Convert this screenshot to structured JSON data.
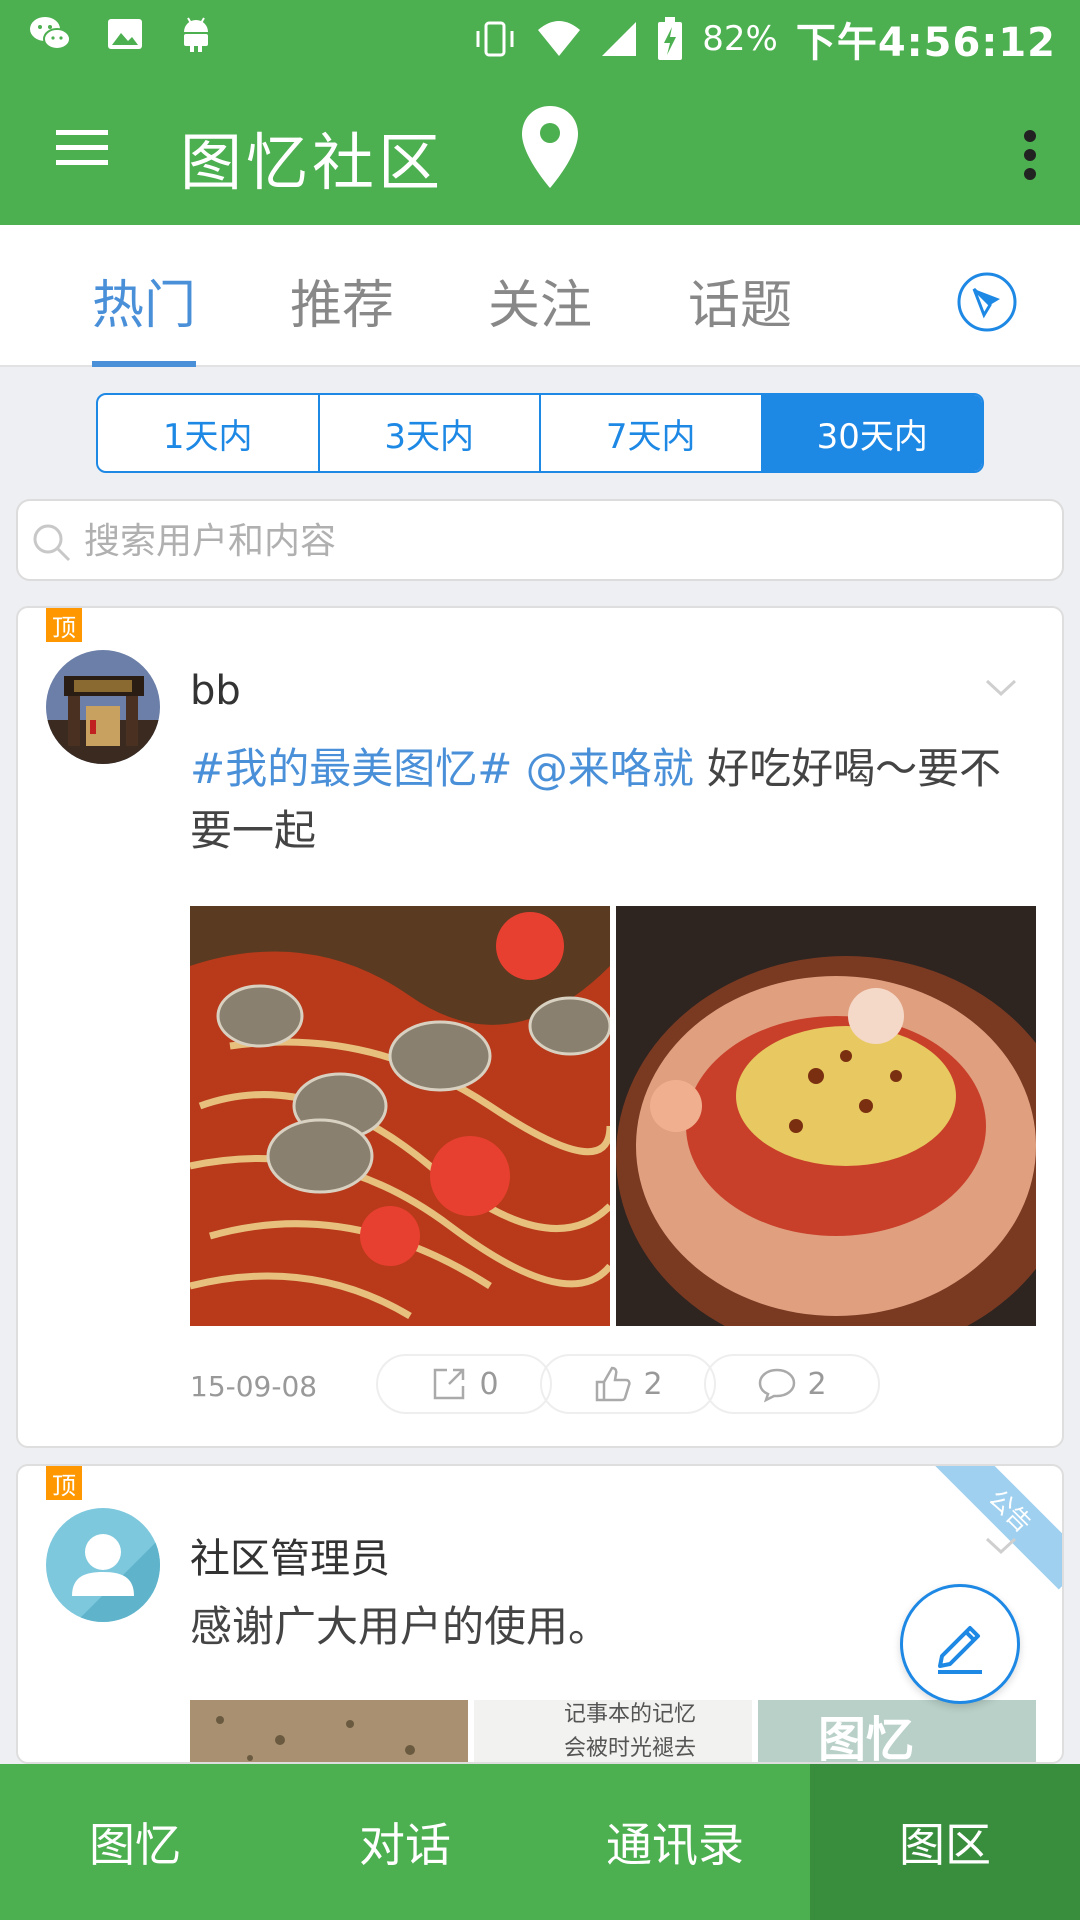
{
  "status_bar": {
    "icons": [
      "wechat-icon",
      "gallery-icon",
      "android-icon",
      "vibrate-icon",
      "wifi-icon",
      "signal-icon",
      "battery-charging-icon"
    ],
    "battery_percent": "82%",
    "time": "下午4:56:12"
  },
  "app_bar": {
    "title": "图忆社区",
    "icons": [
      "menu-icon",
      "location-pin-icon",
      "more-vert-icon"
    ]
  },
  "tabs": [
    {
      "label": "热门",
      "active": true
    },
    {
      "label": "推荐",
      "active": false
    },
    {
      "label": "关注",
      "active": false
    },
    {
      "label": "话题",
      "active": false
    }
  ],
  "filter": {
    "options": [
      "1天内",
      "3天内",
      "7天内",
      "30天内"
    ],
    "selected": "30天内"
  },
  "search": {
    "placeholder": "搜索用户和内容"
  },
  "posts": [
    {
      "pinned_label": "顶",
      "username": "bb",
      "hashtag": "#我的最美图忆#",
      "mention": "@来咯就",
      "text": "好吃好喝～要不要一起",
      "date": "15-09-08",
      "shares": "0",
      "likes": "2",
      "comments": "2"
    },
    {
      "pinned_label": "顶",
      "corner_label": "公告",
      "username": "社区管理员",
      "text": "感谢广大用户的使用。",
      "thumb_caption_1": "记事本的记忆",
      "thumb_caption_2": "会被时光褪去",
      "thumb_caption_3": "图忆"
    }
  ],
  "bottom_nav": [
    {
      "label": "图忆",
      "active": false
    },
    {
      "label": "对话",
      "active": false
    },
    {
      "label": "通讯录",
      "active": false
    },
    {
      "label": "图区",
      "active": true
    }
  ],
  "colors": {
    "primary_green": "#4caf50",
    "dark_green": "#388e3c",
    "accent_blue": "#1e88e5",
    "link_blue": "#4a90d9",
    "pin_orange": "#ff9800"
  }
}
